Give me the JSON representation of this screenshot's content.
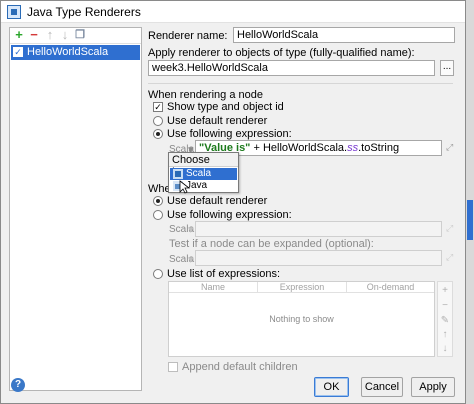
{
  "window": {
    "title": "Java Type Renderers"
  },
  "list": {
    "toolbar": [
      "add-icon",
      "remove-icon",
      "move-up-icon",
      "move-down-icon",
      "copy-icon"
    ],
    "items": [
      {
        "label": "HelloWorldScala",
        "checked": true
      }
    ]
  },
  "renderer_name": {
    "label": "Renderer name:",
    "value": "HelloWorldScala"
  },
  "apply_to": {
    "label": "Apply renderer to objects of type (fully-qualified name):",
    "value": "week3.HelloWorldScala",
    "browse": "..."
  },
  "rendering_node": {
    "section_label": "When rendering a node",
    "show_type_label": "Show type and object id",
    "use_default_label": "Use default renderer",
    "use_following_label": "Use following expression:",
    "lang_label": "Scala",
    "expression_str": "\"Value is\"",
    "expression_rest": " + HelloWorldScala.",
    "expression_field": "ss",
    "expression_tail": ".toString"
  },
  "language_popup": {
    "title": "Choose Language",
    "options": [
      "Scala",
      "Java"
    ],
    "selected": "Scala"
  },
  "expanding_node": {
    "section_label_visible": "When",
    "use_default_label": "Use default renderer",
    "use_following_label": "Use following expression:",
    "lang_label": "Scala",
    "test_label": "Test if a node can be expanded (optional):",
    "lang_label2": "Scala",
    "use_list_label": "Use list of expressions:"
  },
  "table": {
    "columns": [
      "Name",
      "Expression",
      "On-demand"
    ],
    "empty_text": "Nothing to show",
    "side_tools": [
      "add-icon",
      "remove-icon",
      "edit-icon",
      "move-up-icon",
      "move-down-icon"
    ]
  },
  "append_children_label": "Append default children",
  "buttons": {
    "ok": "OK",
    "cancel": "Cancel",
    "apply": "Apply"
  },
  "help": "?",
  "colors": {
    "selection": "#2f6fd0",
    "string_literal": "#1c7a1c",
    "field": "#7a3ad0"
  }
}
